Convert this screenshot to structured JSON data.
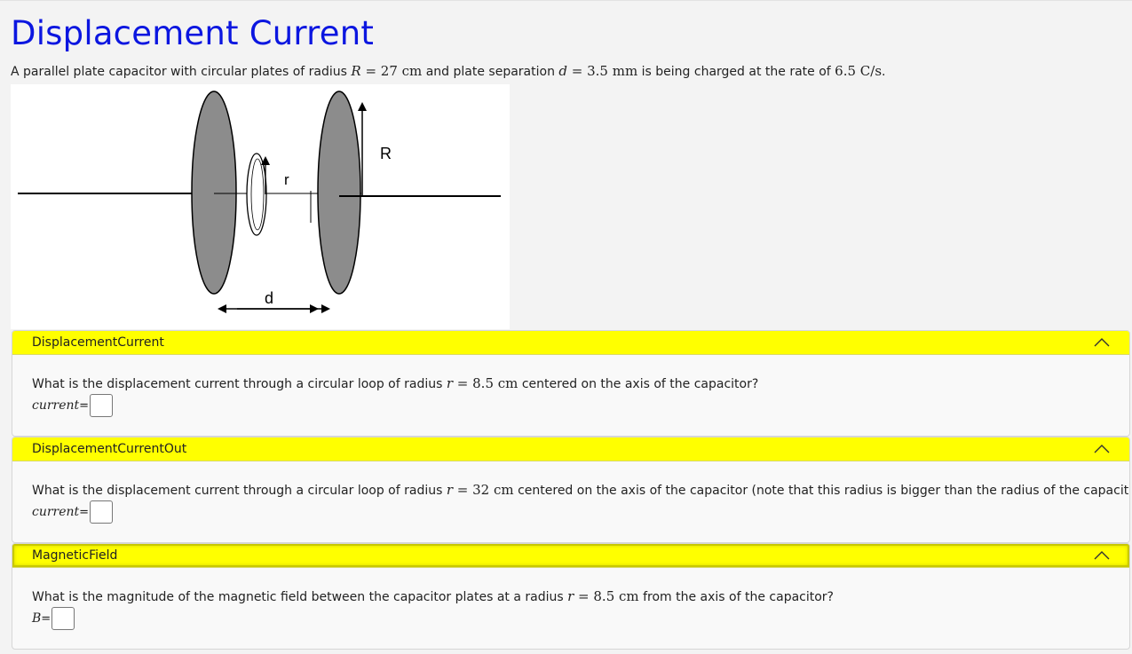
{
  "title": "Displacement Current",
  "intro": {
    "t1": "A parallel plate capacitor with circular plates of radius",
    "R_sym": "R",
    "R_val": " = 27 cm",
    "t2": "and plate separation",
    "d_sym": "d",
    "d_val": " = 3.5 mm",
    "t3": "is being charged at the rate of",
    "rate": "6.5 C/s",
    "t4": "."
  },
  "figure": {
    "label_R": "R",
    "label_r": "r",
    "label_d": "d"
  },
  "panels": [
    {
      "header": "DisplacementCurrent",
      "question_pre": "What is the displacement current through a circular loop of radius",
      "r_sym": "r",
      "r_val": " = 8.5 cm",
      "question_post": "centered on the axis of the capacitor?",
      "answer_label": "current",
      "eq": "="
    },
    {
      "header": "DisplacementCurrentOut",
      "question_pre": "What is the displacement current through a circular loop of radius",
      "r_sym": "r",
      "r_val": " = 32 cm",
      "question_post": "centered on the axis of the capacitor (note that this radius is bigger than the radius of the capacitor)?",
      "answer_label": "current",
      "eq": "="
    },
    {
      "header": "MagneticField",
      "question_pre": "What is the magnitude of the magnetic field between the capacitor plates at a radius",
      "r_sym": "r",
      "r_val": " = 8.5 cm",
      "question_post": "from the axis of the capacitor?",
      "answer_label": "B",
      "eq": "="
    }
  ],
  "colors": {
    "title": "#0b16e0",
    "header_bg": "#ffff00",
    "plate": "#8c8c8c"
  },
  "icons": {
    "collapse": "chevron-up-icon"
  }
}
